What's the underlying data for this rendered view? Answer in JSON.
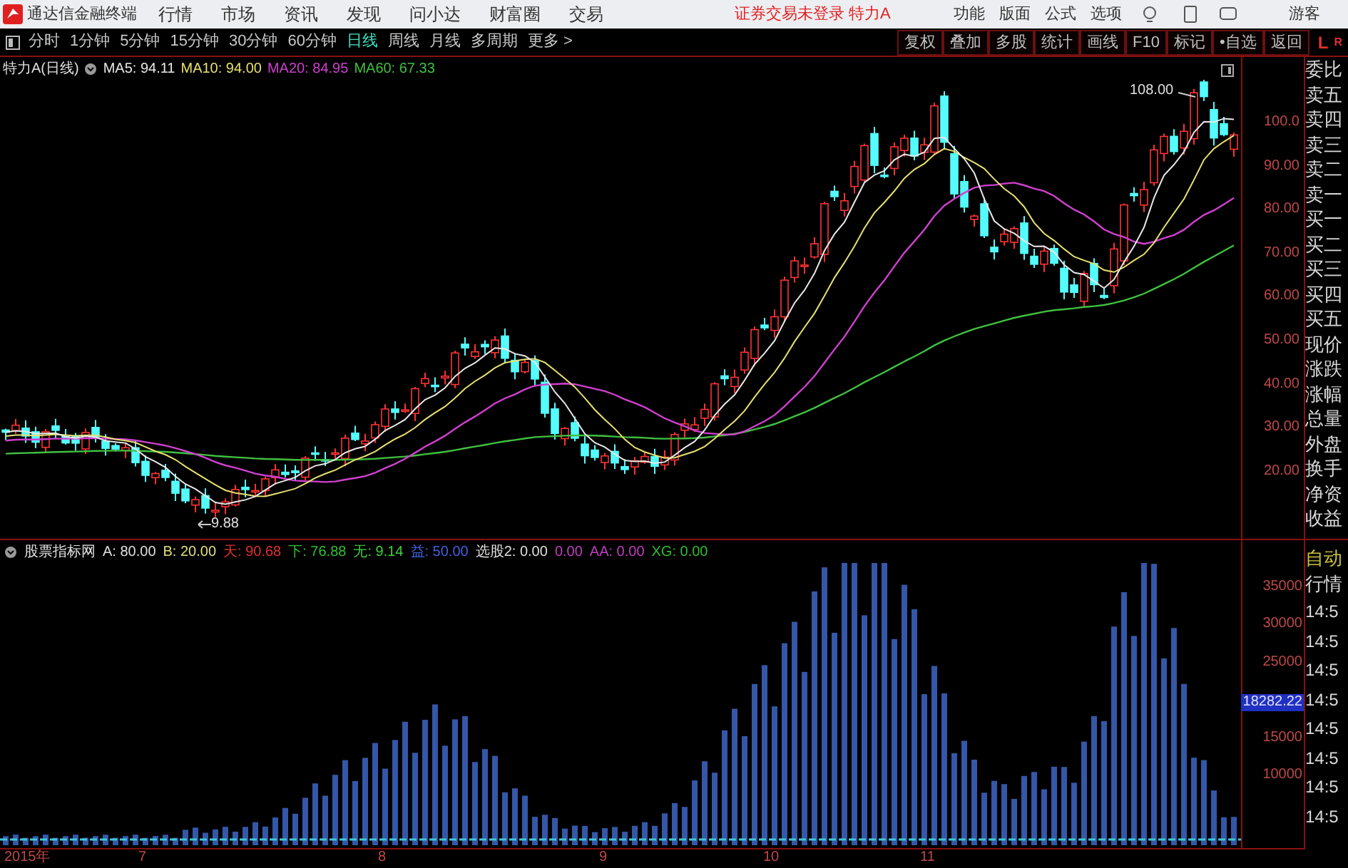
{
  "title_bar": {
    "app_name": "通达信金融终端",
    "menu": [
      "行情",
      "市场",
      "资讯",
      "发现",
      "问小达",
      "财富圈",
      "交易"
    ],
    "notice": "证券交易未登录 特力A",
    "right_menu": [
      "功能",
      "版面",
      "公式",
      "选项"
    ],
    "user": "游客"
  },
  "toolbar": {
    "periods": [
      {
        "label": "分时",
        "selected": false
      },
      {
        "label": "1分钟",
        "selected": false
      },
      {
        "label": "5分钟",
        "selected": false
      },
      {
        "label": "15分钟",
        "selected": false
      },
      {
        "label": "30分钟",
        "selected": false
      },
      {
        "label": "60分钟",
        "selected": false
      },
      {
        "label": "日线",
        "selected": true
      },
      {
        "label": "周线",
        "selected": false
      },
      {
        "label": "月线",
        "selected": false
      },
      {
        "label": "多周期",
        "selected": false
      },
      {
        "label": "更多 >",
        "selected": false
      }
    ],
    "buttons": [
      "复权",
      "叠加",
      "多股",
      "统计",
      "画线",
      "F10",
      "标记",
      "•自选",
      "返回"
    ],
    "corner": [
      "L",
      "R"
    ]
  },
  "price_chart": {
    "title": "特力A(日线)",
    "indicators": [
      {
        "label": "MA5: 94.11",
        "color": "#e8e8e8"
      },
      {
        "label": "MA10: 94.00",
        "color": "#e8e070"
      },
      {
        "label": "MA20: 84.95",
        "color": "#d040d0"
      },
      {
        "label": "MA60: 67.33",
        "color": "#40c040"
      }
    ],
    "axis": [
      "100.0",
      "90.00",
      "80.00",
      "70.00",
      "60.00",
      "50.00",
      "40.00",
      "30.00",
      "20.00"
    ],
    "high_label": "108.00",
    "low_label": "9.88"
  },
  "indicator_panel": {
    "title": "股票指标网",
    "values": [
      {
        "label": "A: 80.00",
        "color": "#e0e0e0"
      },
      {
        "label": "B: 20.00",
        "color": "#e0e080"
      },
      {
        "label": "天: 90.68",
        "color": "#e03030"
      },
      {
        "label": "下: 76.88",
        "color": "#30c030"
      },
      {
        "label": "无: 9.14",
        "color": "#40d040"
      },
      {
        "label": "益: 50.00",
        "color": "#4060e0"
      },
      {
        "label": "选股2: 0.00",
        "color": "#e0e0e0"
      },
      {
        "label": "0.00",
        "color": "#c040c0"
      },
      {
        "label": "AA: 0.00",
        "color": "#c040c0"
      },
      {
        "label": "XG: 0.00",
        "color": "#30c030"
      }
    ],
    "axis": [
      {
        "text": "35000",
        "kind": "tick"
      },
      {
        "text": "30000",
        "kind": "tick"
      },
      {
        "text": "25000",
        "kind": "tick"
      },
      {
        "text": "18282.22",
        "kind": "marker"
      },
      {
        "text": "15000",
        "kind": "tick"
      },
      {
        "text": "10000",
        "kind": "tick"
      }
    ]
  },
  "time_axis": [
    "2015年",
    "7",
    "8",
    "9",
    "10",
    "11"
  ],
  "quote_panel": {
    "labels": [
      "委比",
      "卖五",
      "卖四",
      "卖三",
      "卖二",
      "卖一",
      "买一",
      "买二",
      "买三",
      "买四",
      "买五",
      "现价",
      "涨跌",
      "涨幅",
      "总量",
      "外盘",
      "换手",
      "净资",
      "收益"
    ],
    "mode": [
      "自动",
      "行情"
    ],
    "times": [
      "14:5",
      "14:5",
      "14:5",
      "14:5",
      "14:5",
      "14:5",
      "14:5",
      "14:5"
    ]
  }
}
